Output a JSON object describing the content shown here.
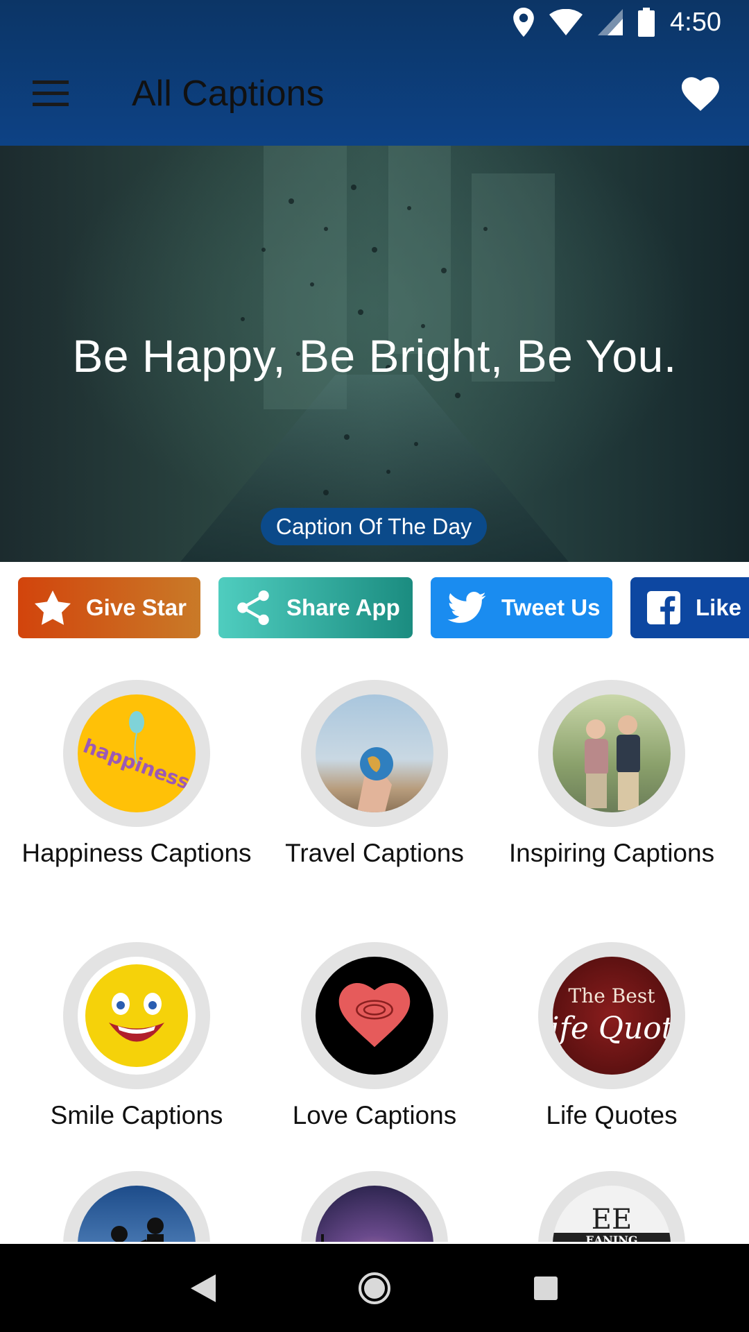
{
  "status_bar": {
    "time": "4:50",
    "icons": [
      "location-icon",
      "wifi-icon",
      "signal-icon",
      "battery-icon"
    ]
  },
  "app_bar": {
    "title": "All Captions",
    "menu_icon": "hamburger-menu-icon",
    "favorite_icon": "heart-icon"
  },
  "hero": {
    "quote": "Be Happy, Be Bright, Be You.",
    "badge": "Caption Of The Day"
  },
  "actions": [
    {
      "label": "Give Star",
      "icon": "star-icon",
      "color": "#d2440c"
    },
    {
      "label": "Share App",
      "icon": "share-icon",
      "color": "#2aa99b"
    },
    {
      "label": "Tweet Us",
      "icon": "twitter-icon",
      "color": "#1a8cf0"
    },
    {
      "label": "Like U",
      "icon": "facebook-icon",
      "color": "#0d47a1"
    }
  ],
  "categories": [
    {
      "label": "Happiness Captions",
      "image_text": "happiness"
    },
    {
      "label": "Travel Captions"
    },
    {
      "label": "Inspiring Captions"
    },
    {
      "label": "Smile Captions"
    },
    {
      "label": "Love Captions"
    },
    {
      "label": "Life Quotes",
      "image_text_1": "The Best",
      "image_text_2": "ife Quot"
    },
    {
      "label": ""
    },
    {
      "label": ""
    },
    {
      "label": "",
      "image_text_1": "EE",
      "image_text_2": "EANING"
    }
  ],
  "nav_bar": {
    "back": "back-icon",
    "home": "home-icon",
    "recents": "recents-icon"
  }
}
